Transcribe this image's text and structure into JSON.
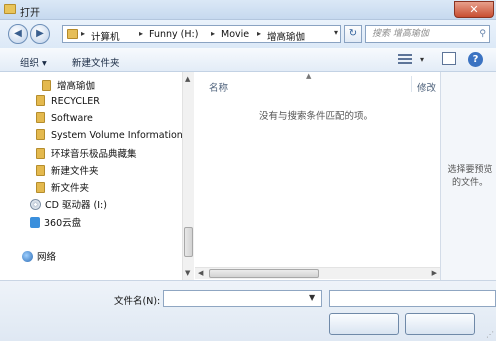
{
  "window": {
    "title": "打开",
    "close": "✕"
  },
  "nav": {
    "back": "◀",
    "forward": "▶"
  },
  "breadcrumb": {
    "sep": "▸",
    "items": [
      "计算机",
      "Funny (H:)",
      "Movie",
      "增高瑜伽"
    ],
    "dropdown": "▾"
  },
  "refresh": "↻",
  "search": {
    "placeholder": "搜索 增高瑜伽",
    "icon": "⚲"
  },
  "toolbar": {
    "organize": "组织 ▾",
    "new_folder": "新建文件夹",
    "view_dropdown": "▾",
    "help": "?"
  },
  "sidebar": {
    "items": [
      {
        "label": "增高瑜伽",
        "icon": "folder-icon"
      },
      {
        "label": "RECYCLER",
        "icon": "folder-icon"
      },
      {
        "label": "Software",
        "icon": "folder-icon"
      },
      {
        "label": "System Volume Information",
        "icon": "folder-icon"
      },
      {
        "label": "环球音乐极品典藏集",
        "icon": "folder-icon"
      },
      {
        "label": "新建文件夹",
        "icon": "folder-icon"
      },
      {
        "label": "新文件夹",
        "icon": "folder-icon"
      },
      {
        "label": "CD 驱动器 (I:)",
        "icon": "cd-drive-icon"
      },
      {
        "label": "360云盘",
        "icon": "cloud-drive-icon"
      },
      {
        "label": "网络",
        "icon": "network-icon"
      }
    ]
  },
  "list": {
    "col_name": "名称",
    "col_modified": "修改",
    "sort_arrow": "▲",
    "empty_message": "没有与搜索条件匹配的项。"
  },
  "scroll": {
    "up": "▲",
    "down": "▼",
    "left": "◀",
    "right": "▶"
  },
  "preview": {
    "message": "选择要预览的文件。"
  },
  "filename": {
    "label": "文件名(N):",
    "value": "",
    "dropdown": "▼"
  },
  "colors": {
    "titlebar": "#c6d9ef",
    "accent": "#3b73c2",
    "folder": "#e4b94e"
  }
}
